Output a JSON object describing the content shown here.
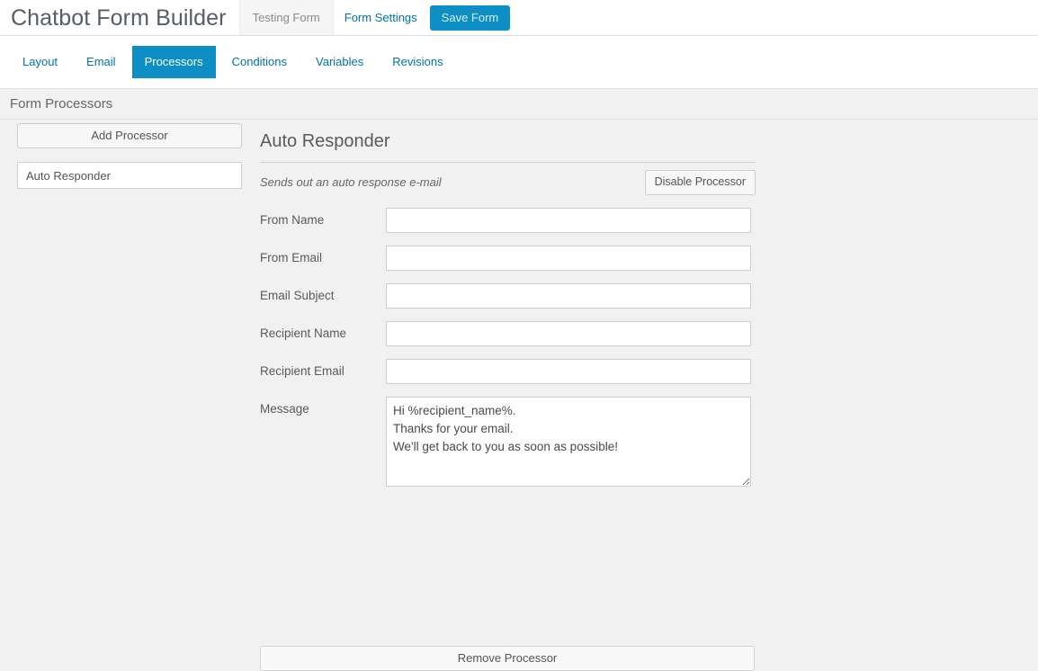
{
  "header": {
    "app_title": "Chatbot Form Builder",
    "tab_label": "Testing Form",
    "form_settings_label": "Form Settings",
    "save_label": "Save Form",
    "accent_color": "#0d8ec4",
    "link_color": "#0073aa"
  },
  "nav": {
    "items": [
      {
        "label": "Layout",
        "active": false
      },
      {
        "label": "Email",
        "active": false
      },
      {
        "label": "Processors",
        "active": true
      },
      {
        "label": "Conditions",
        "active": false
      },
      {
        "label": "Variables",
        "active": false
      },
      {
        "label": "Revisions",
        "active": false
      }
    ]
  },
  "section": {
    "title": "Form Processors"
  },
  "sidebar": {
    "add_processor_label": "Add Processor",
    "processors": [
      {
        "label": "Auto Responder",
        "selected": true
      }
    ]
  },
  "content": {
    "heading": "Auto Responder",
    "description": "Sends out an auto response e-mail",
    "disable_label": "Disable Processor",
    "remove_label": "Remove Processor",
    "fields": [
      {
        "label": "From Name",
        "value": "",
        "placeholder": "",
        "type": "text"
      },
      {
        "label": "From Email",
        "value": "",
        "placeholder": "",
        "type": "text"
      },
      {
        "label": "Email Subject",
        "value": "",
        "placeholder": "",
        "type": "text"
      },
      {
        "label": "Recipient Name",
        "value": "",
        "placeholder": "",
        "type": "text"
      },
      {
        "label": "Recipient Email",
        "value": "",
        "placeholder": "",
        "type": "text"
      }
    ],
    "message_field": {
      "label": "Message",
      "value": "Hi %recipient_name%.\nThanks for your email.\nWe'll get back to you as soon as possible!",
      "placeholder": ""
    }
  }
}
